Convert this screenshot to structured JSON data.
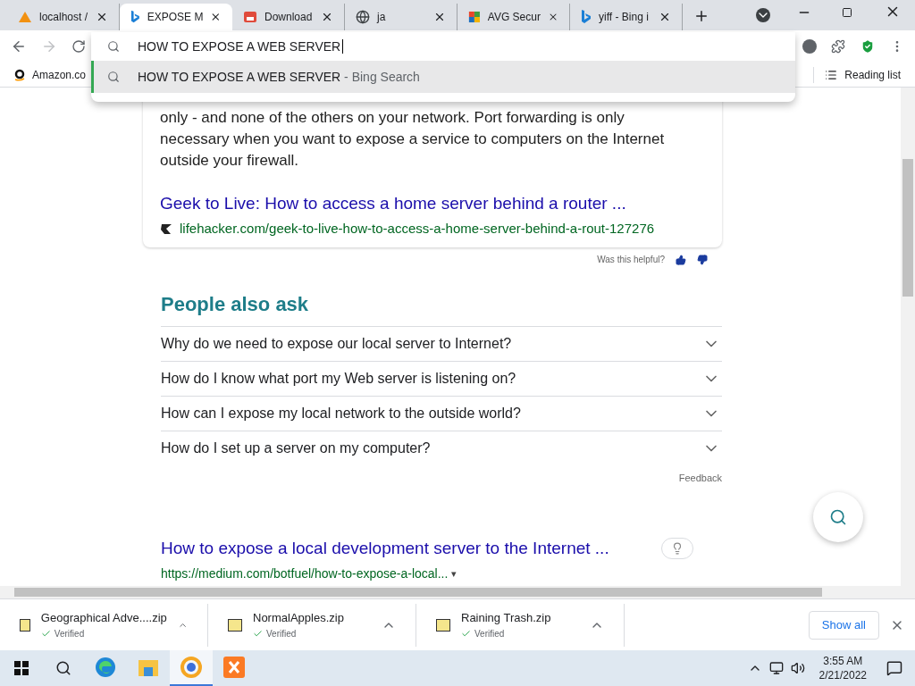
{
  "tabs": [
    {
      "title": "localhost /",
      "kind": "pma",
      "selected": false
    },
    {
      "title": "EXPOSE M",
      "kind": "bing",
      "selected": true
    },
    {
      "title": "Download",
      "kind": "store",
      "selected": false
    },
    {
      "title": "ja",
      "kind": "globe",
      "selected": false
    },
    {
      "title": "AVG Secur",
      "kind": "avg",
      "selected": false
    },
    {
      "title": "yiff - Bing i",
      "kind": "bing",
      "selected": false
    }
  ],
  "omnibox": {
    "value": "HOW TO EXPOSE A WEB SERVER",
    "suggestions": [
      {
        "query": "HOW TO EXPOSE A WEB SERVER",
        "separator": "-",
        "source": "Bing Search",
        "selected": true
      }
    ]
  },
  "toolbar": {
    "forward_disabled": true
  },
  "bookmarks": [
    {
      "label": "Amazon.co"
    }
  ],
  "reading_list": "Reading list",
  "snippet": {
    "lines": [
      "only - and none of the others on your network. Port forwarding is only",
      "necessary when you want to expose a service to computers on the Internet",
      "outside your firewall."
    ],
    "link": "Geek to Live: How to access a home server behind a router ...",
    "url": "lifehacker.com/geek-to-live-how-to-access-a-home-server-behind-a-rout-127276"
  },
  "helpful": "Was this helpful?",
  "people_also_ask": {
    "title": "People also ask",
    "questions": [
      {
        "text": "Why do we need to expose our local server to Internet?",
        "expanded": false
      },
      {
        "text": "How do I know what port my Web server is listening on?",
        "expanded": false
      },
      {
        "text": "How can I expose my local network to the outside world?",
        "expanded": false
      },
      {
        "text": "How do I set up a server on my computer?",
        "expanded": false
      }
    ],
    "feedback": "Feedback"
  },
  "result": {
    "title": "How to expose a local development server to the Internet ...",
    "url": "https://medium.com/botfuel/how-to-expose-a-local...",
    "url_caret": "▾"
  },
  "downloads": [
    {
      "name": "Geographical Adve....zip",
      "status": "Verified"
    },
    {
      "name": "NormalApples.zip",
      "status": "Verified"
    },
    {
      "name": "Raining Trash.zip",
      "status": "Verified"
    }
  ],
  "show_all": "Show all",
  "taskbar": {
    "apps": [
      {
        "kind": "edge",
        "active": false
      },
      {
        "kind": "explorer",
        "active": false
      },
      {
        "kind": "browser",
        "active": true
      },
      {
        "kind": "xampp",
        "active": false
      }
    ],
    "time": "3:55 AM",
    "date": "2/21/2022"
  }
}
